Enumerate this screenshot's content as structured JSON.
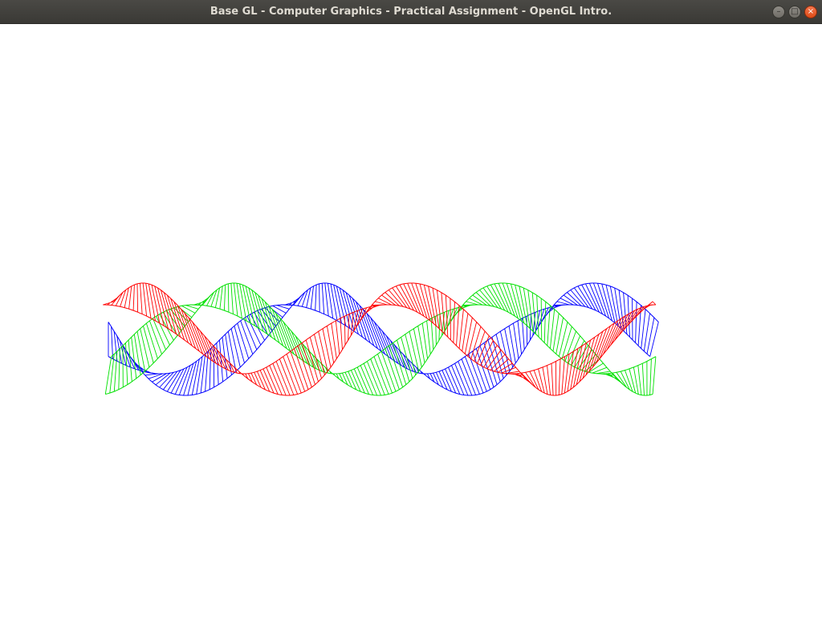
{
  "window": {
    "title": "Base GL - Computer Graphics - Practical Assignment - OpenGL Intro.",
    "controls": {
      "minimize_icon": "minimize-icon",
      "maximize_icon": "maximize-icon",
      "close_icon": "close-icon"
    }
  },
  "canvas": {
    "background": "#ffffff",
    "ribbons": [
      {
        "name": "blue",
        "color": "#0000ff"
      },
      {
        "name": "green",
        "color": "#00e000"
      },
      {
        "name": "red",
        "color": "#ff0000"
      }
    ]
  }
}
